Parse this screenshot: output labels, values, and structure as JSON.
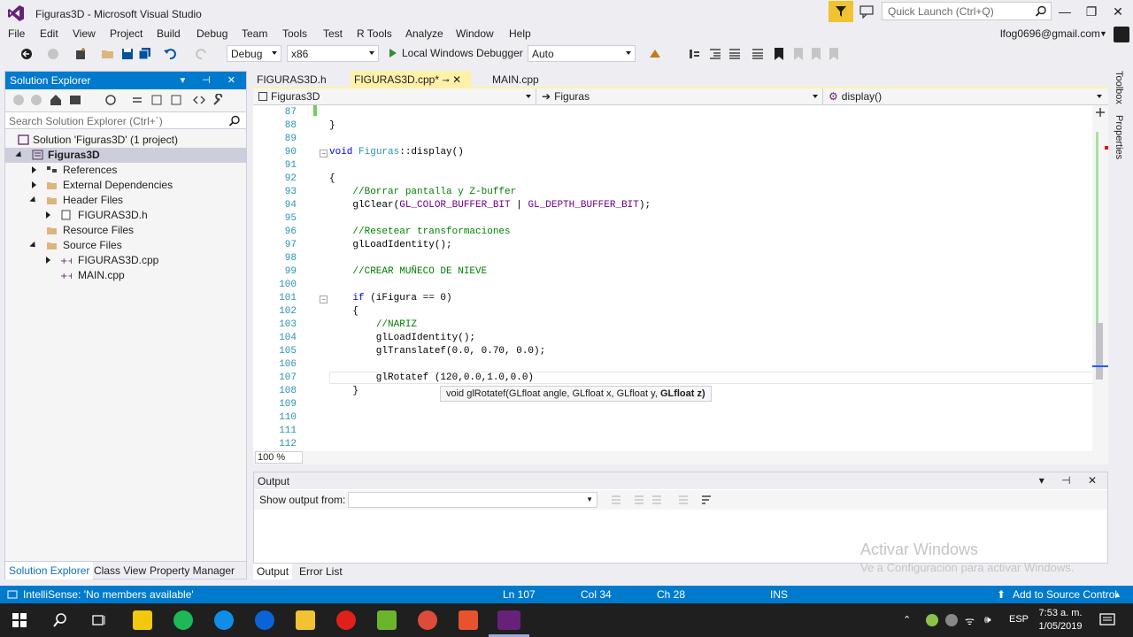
{
  "window": {
    "title": "Figuras3D - Microsoft Visual Studio",
    "quick_launch_placeholder": "Quick Launch (Ctrl+Q)",
    "min": "—",
    "max": "❐",
    "close": "✕"
  },
  "menu": [
    "File",
    "Edit",
    "View",
    "Project",
    "Build",
    "Debug",
    "Team",
    "Tools",
    "Test",
    "R Tools",
    "Analyze",
    "Window",
    "Help"
  ],
  "user": {
    "email": "lfog0696@gmail.com"
  },
  "toolbar": {
    "config": "Debug",
    "platform": "x86",
    "run_label": "Local Windows Debugger",
    "run_mode": "Auto"
  },
  "solution_explorer": {
    "title": "Solution Explorer",
    "search_placeholder": "Search Solution Explorer (Ctrl+´)",
    "tree": [
      {
        "label": "Solution 'Figuras3D' (1 project)"
      },
      {
        "label": "Figuras3D"
      },
      {
        "label": "References"
      },
      {
        "label": "External Dependencies"
      },
      {
        "label": "Header Files"
      },
      {
        "label": "FIGURAS3D.h"
      },
      {
        "label": "Resource Files"
      },
      {
        "label": "Source Files"
      },
      {
        "label": "FIGURAS3D.cpp"
      },
      {
        "label": "MAIN.cpp"
      }
    ],
    "tabs": [
      "Solution Explorer",
      "Class View",
      "Property Manager"
    ]
  },
  "doc_tabs": [
    "FIGURAS3D.h",
    "FIGURAS3D.cpp*",
    "MAIN.cpp"
  ],
  "navbar": {
    "project": "Figuras3D",
    "scope": "Figuras",
    "member": "display()"
  },
  "editor": {
    "line_numbers": [
      "87",
      "88",
      "89",
      "90",
      "91",
      "92",
      "93",
      "94",
      "95",
      "96",
      "97",
      "98",
      "99",
      "100",
      "101",
      "102",
      "103",
      "104",
      "105",
      "106",
      "107",
      "108",
      "109",
      "110",
      "111",
      "112"
    ],
    "tooltip": "void glRotatef(GLfloat angle, GLfloat x, GLfloat y,",
    "tooltip_bold": "GLfloat z)",
    "zoom": "100 %"
  },
  "output": {
    "title": "Output",
    "show_from": "Show output from:",
    "tabs": [
      "Output",
      "Error List"
    ]
  },
  "watermark": {
    "line1": "Activar Windows",
    "line2": "Ve a Configuración para activar Windows."
  },
  "side_strip": [
    "Toolbox",
    "Properties"
  ],
  "status": {
    "message": "IntelliSense: 'No members available'",
    "ln": "Ln 107",
    "col": "Col 34",
    "ch": "Ch 28",
    "ins": "INS",
    "source_control": "Add to Source Control"
  },
  "taskbar": {
    "lang": "ESP",
    "time": "7:53 a. m.",
    "date": "1/05/2019"
  },
  "colors": {
    "accent": "#007acc",
    "active_tab": "#fff1a8"
  }
}
